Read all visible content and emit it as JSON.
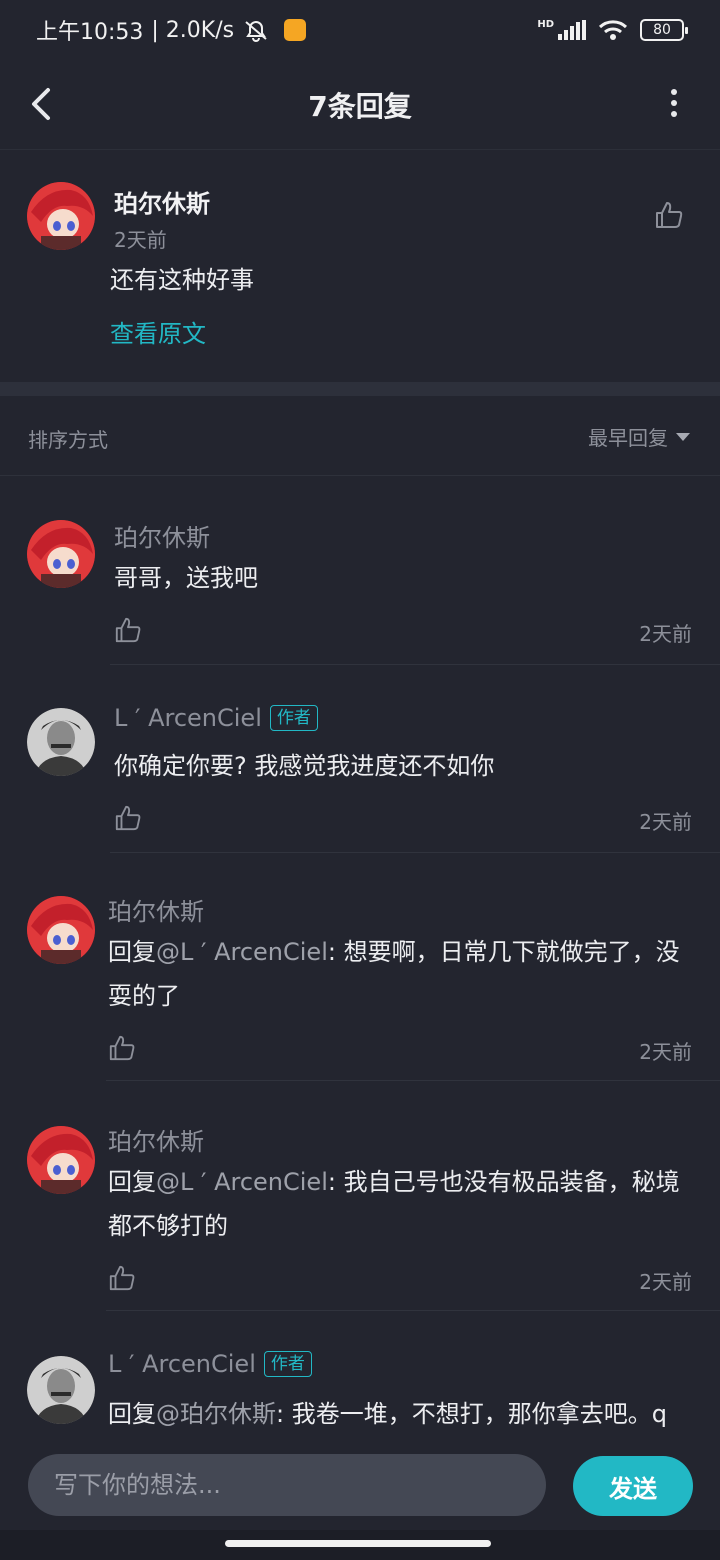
{
  "status_bar": {
    "time": "上午10:53",
    "network_speed": "| 2.0K/s",
    "battery": "80",
    "network_type": "HD"
  },
  "header": {
    "title": "7条回复"
  },
  "main_comment": {
    "author": "珀尔休斯",
    "time": "2天前",
    "text": "还有这种好事",
    "view_original": "查看原文"
  },
  "sort": {
    "label": "排序方式",
    "selected": "最早回复"
  },
  "replies": [
    {
      "author": "珀尔休斯",
      "is_author": false,
      "prefix": "",
      "mention": "",
      "text": "哥哥，送我吧",
      "time": "2天前"
    },
    {
      "author": "L ′ ArcenCiel",
      "is_author": true,
      "author_badge": "作者",
      "prefix": "",
      "mention": "",
      "text": "你确定你要? 我感觉我进度还不如你",
      "time": "2天前"
    },
    {
      "author": "珀尔休斯",
      "is_author": false,
      "prefix": "回复",
      "mention": "@L ′ ArcenCiel",
      "text": ": 想要啊，日常几下就做完了，没耍的了",
      "time": "2天前"
    },
    {
      "author": "珀尔休斯",
      "is_author": false,
      "prefix": "回复",
      "mention": "@L ′ ArcenCiel",
      "text": ": 我自己号也没有极品装备，秘境都不够打的",
      "time": "2天前"
    },
    {
      "author": "L ′ ArcenCiel",
      "is_author": true,
      "author_badge": "作者",
      "prefix": "回复",
      "mention": "@珀尔休斯",
      "text": ": 我卷一堆，不想打，那你拿去吧。q",
      "time": ""
    }
  ],
  "input_bar": {
    "placeholder": "写下你的想法...",
    "send_label": "发送"
  },
  "colors": {
    "background": "#23252f",
    "accent": "#22b8c5",
    "muted_text": "#8d909a"
  },
  "icons": {
    "back": "chevron-left-icon",
    "more": "more-vertical-icon",
    "like": "thumbs-up-icon",
    "dropdown": "caret-down-icon",
    "mute": "bell-off-icon"
  }
}
